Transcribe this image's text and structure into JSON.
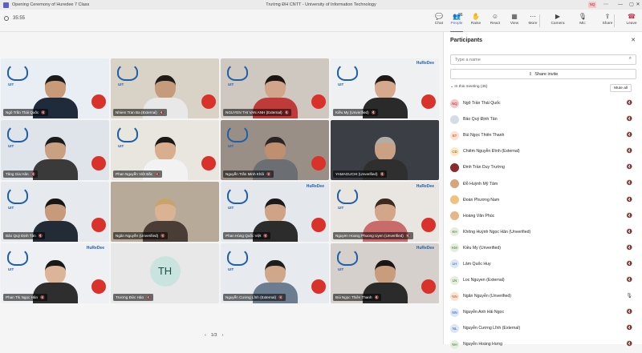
{
  "window": {
    "title": "Opening Ceremony of Huredee 7 Class",
    "center_title": "Trường ĐH CNTT - University of Information Technology",
    "org_badge": "NQ",
    "controls": [
      "—",
      "▢",
      "✕"
    ]
  },
  "toolbar": {
    "timer": "35:55",
    "buttons": [
      {
        "id": "chat",
        "label": "Chat",
        "icon": "chat-icon",
        "glyph": "💬"
      },
      {
        "id": "people",
        "label": "People",
        "icon": "people-icon",
        "glyph": "👥",
        "count": "36"
      },
      {
        "id": "raise",
        "label": "Raise",
        "icon": "raise-hand-icon",
        "glyph": "✋"
      },
      {
        "id": "react",
        "label": "React",
        "icon": "react-icon",
        "glyph": "☺"
      },
      {
        "id": "view",
        "label": "View",
        "icon": "view-icon",
        "glyph": "▦"
      },
      {
        "id": "more",
        "label": "More",
        "icon": "more-icon",
        "glyph": "⋯"
      },
      {
        "id": "camera",
        "label": "Camera",
        "icon": "camera-icon",
        "glyph": "▶"
      },
      {
        "id": "mic",
        "label": "Mic",
        "icon": "mic-icon",
        "glyph": "🎙"
      },
      {
        "id": "share",
        "label": "Share",
        "icon": "share-icon",
        "glyph": "⇪"
      },
      {
        "id": "leave",
        "label": "Leave",
        "icon": "leave-icon",
        "glyph": "☎"
      }
    ]
  },
  "grid": {
    "tiles": [
      {
        "name": "Ngô Trần Thái Quốc",
        "muted": true
      },
      {
        "name": "Nhiem Tran Ba (External)",
        "muted": true
      },
      {
        "name": "NGUYEN THI VAN ANH (External)",
        "muted": true
      },
      {
        "name": "Kiều My (Unverified)",
        "muted": true
      },
      {
        "name": "Tăng Gia Hân",
        "muted": true
      },
      {
        "name": "Phan Nguyễn Việt Bắc",
        "muted": true
      },
      {
        "name": "Nguyễn Trần Minh Khôi",
        "muted": true
      },
      {
        "name": "YAMAGUCHI (Unverified)",
        "muted": true
      },
      {
        "name": "Bảo Quý Định Tân",
        "muted": true
      },
      {
        "name": "Ngân Nguyễn (Unverified)",
        "muted": true
      },
      {
        "name": "Phan Hùng Quốc Việt",
        "muted": true
      },
      {
        "name": "Nguyen Hoang Phuong Uyen (Unverified)",
        "muted": true
      },
      {
        "name": "Phan Thị Ngọc Hân",
        "muted": true
      },
      {
        "name": "Trương Đức Hảo",
        "muted": true,
        "initials": "TH"
      },
      {
        "name": "Nguyễn Cương Lĩnh (External)",
        "muted": true
      },
      {
        "name": "Bùi Ngọc Thiên Thanh",
        "muted": true
      }
    ],
    "logo_text": "UIT",
    "brand_text": "HuReDee",
    "pager": {
      "prev": "‹",
      "label": "1/3",
      "next": "›"
    }
  },
  "panel": {
    "title": "Participants",
    "close_icon": "✕",
    "search_placeholder": "Type a name",
    "share_invite": "Share invite",
    "section_label": "In this meeting (36)",
    "mute_all": "Mute all",
    "participants": [
      {
        "name": "Ngô Trần Thái Quốc",
        "initials": "NQ",
        "avatar_bg": "#f3c7c7",
        "avatar_fg": "#a4262c"
      },
      {
        "name": "Bảo Quý Định Tân",
        "initials": "",
        "avatar_bg": "#d7dbe6",
        "avatar_fg": "#424242"
      },
      {
        "name": "Bùi Ngọc Thiên Thanh",
        "initials": "BT",
        "avatar_bg": "#fde2d2",
        "avatar_fg": "#b5461c"
      },
      {
        "name": "Chiêm Nguyễn Đình (External)",
        "initials": "CĐ",
        "avatar_bg": "#fde8c4",
        "avatar_fg": "#8a5a00"
      },
      {
        "name": "Đinh Trần Duy Trường",
        "initials": "",
        "avatar_bg": "#8a2a2a",
        "avatar_fg": "#ffffff"
      },
      {
        "name": "Đỗ Huỳnh Mỹ Tâm",
        "initials": "",
        "avatar_bg": "#d8a47a",
        "avatar_fg": "#ffffff"
      },
      {
        "name": "Đoàn Phương Nam",
        "initials": "",
        "avatar_bg": "#f1c27d",
        "avatar_fg": "#ffffff"
      },
      {
        "name": "Hoàng Văn Phúc",
        "initials": "",
        "avatar_bg": "#e7b589",
        "avatar_fg": "#ffffff"
      },
      {
        "name": "Không Huỳnh Ngọc Hân (Unverified)",
        "initials": "KH",
        "avatar_bg": "#e3efdc",
        "avatar_fg": "#3c6b2a"
      },
      {
        "name": "Kiều My (Unverified)",
        "initials": "KM",
        "avatar_bg": "#e3efdc",
        "avatar_fg": "#3c6b2a"
      },
      {
        "name": "Lâm Quốc Huy",
        "initials": "LH",
        "avatar_bg": "#dbe6f6",
        "avatar_fg": "#2b5797"
      },
      {
        "name": "Loc Nguyen (External)",
        "initials": "LN",
        "avatar_bg": "#e3efdc",
        "avatar_fg": "#3c6b2a"
      },
      {
        "name": "Ngân Nguyễn (Unverified)",
        "initials": "NN",
        "avatar_bg": "#fde2d2",
        "avatar_fg": "#b5461c",
        "mic_on": true
      },
      {
        "name": "Nguyễn Anh Hải Ngọc",
        "initials": "NN",
        "avatar_bg": "#dbe6f6",
        "avatar_fg": "#2b5797"
      },
      {
        "name": "Nguyễn Cương Lĩnh (External)",
        "initials": "NL",
        "avatar_bg": "#dbe6f6",
        "avatar_fg": "#2b5797"
      },
      {
        "name": "Nguyễn Hoàng Hưng",
        "initials": "NH",
        "avatar_bg": "#e3efdc",
        "avatar_fg": "#3c6b2a"
      }
    ]
  }
}
